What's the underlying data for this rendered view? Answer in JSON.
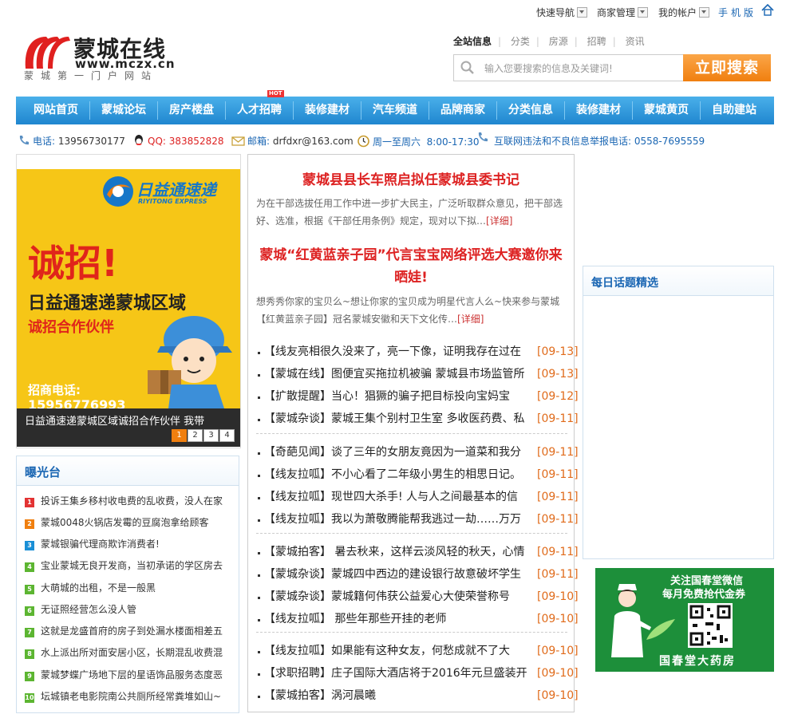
{
  "topbar": {
    "quick_nav": "快速导航",
    "merchant": "商家管理",
    "account": "我的帐户",
    "mobile": "手机版"
  },
  "logo": {
    "name": "蒙城在线",
    "url": "www.mczx.cn",
    "slogan": "蒙城第一门户网站"
  },
  "search": {
    "tabs": [
      "全站信息",
      "分类",
      "房源",
      "招聘",
      "资讯"
    ],
    "placeholder": "输入您要搜索的信息及关键词!",
    "button": "立即搜索"
  },
  "nav": {
    "items": [
      "网站首页",
      "蒙城论坛",
      "房产楼盘",
      "人才招聘",
      "装修建材",
      "汽车频道",
      "品牌商家",
      "分类信息",
      "装修建材",
      "蒙城黄页",
      "自助建站"
    ],
    "hot_badge": "HOT"
  },
  "contact": {
    "phone_label": "电话:",
    "phone": "13956730177",
    "qq_label": "QQ:",
    "qq": "383852828",
    "mail_label": "邮箱:",
    "mail": "drfdxr@163.com",
    "hours_days": "周一至周六",
    "hours_time": "8:00-17:30",
    "report_label": "互联网违法和不良信息举报电话:",
    "report_phone": "0558-7695559"
  },
  "banner": {
    "brand": "日益通速递",
    "brand_en": "RIYITONG EXPRESS",
    "headline": "诚招!",
    "line1": "日益通速递蒙城区域",
    "line2": "诚招合作伙伴",
    "phone_label": "招商电话:",
    "phone": "15956776993",
    "caption": "日益通速递蒙城区域诚招合作伙伴 我带",
    "pages": [
      "1",
      "2",
      "3",
      "4"
    ]
  },
  "exposure": {
    "title": "曝光台",
    "items": [
      "投诉王集乡移村收电费的乱收费，没人在家",
      "蒙城0048火锅店发霉的豆腐泡拿给顾客",
      "蒙城银骗代理商欺诈消费者!",
      "宝业蒙城无良开发商，当初承诺的学区房去",
      "大萌城的出租，不是一般黑",
      "无证照经营怎么没人管",
      "这就是龙盛首府的房子到处漏水楼面相差五",
      "水上派出所对面安居小区，长期混乱收费混",
      "蒙城梦蝶广场地下层的星语饰品服务态度恶",
      "坛城镇老电影院南公共厕所经常粪堆如山~"
    ],
    "colors": [
      "#e33333",
      "#f07f0f",
      "#1a8fd6",
      "#5cb531",
      "#5cb531",
      "#5cb531",
      "#5cb531",
      "#5cb531",
      "#5cb531",
      "#5cb531"
    ]
  },
  "center": {
    "headline1": "蒙城县县长车照启拟任蒙城县委书记",
    "summary1": "为在干部选拔任用工作中进一步扩大民主，广泛听取群众意见，把干部选好、选准，根据《干部任用条例》规定，现对以下拟…",
    "headline2": "蒙城“红黄蓝亲子园”代言宝宝网络评选大赛邀你来晒娃!",
    "summary2": "想秀秀你家的宝贝么~想让你家的宝贝成为明星代言人么~快来参与蒙城【红黄蓝亲子园】冠名蒙城安徽和天下文化传…",
    "more_label": "[详细]",
    "groups": [
      [
        {
          "title": "【线友亮相很久没来了，亮一下像，证明我存在过在",
          "date": "[09-13]"
        },
        {
          "title": "【蒙城在线】图便宜买拖拉机被骗 蒙城县市场监管所",
          "date": "[09-13]"
        },
        {
          "title": "【扩散提醒】当心！猖獗的骗子把目标投向宝妈宝",
          "date": "[09-12]"
        },
        {
          "title": "【蒙城杂谈】蒙城王集个别村卫生室 多收医药费、私",
          "date": "[09-11]"
        }
      ],
      [
        {
          "title": "【奇葩见闻】谈了三年的女朋友竟因为一道菜和我分",
          "date": "[09-11]"
        },
        {
          "title": "【线友拉呱】不小心看了二年级小男生的相思日记。",
          "date": "[09-11]"
        },
        {
          "title": "【线友拉呱】现世四大杀手! 人与人之间最基本的信",
          "date": "[09-11]"
        },
        {
          "title": "【线友拉呱】我以为萧敬腾能帮我逃过一劫……万万",
          "date": "[09-11]"
        }
      ],
      [
        {
          "title": "【蒙城拍客】 暑去秋来，这样云淡风轻的秋天，心情",
          "date": "[09-11]"
        },
        {
          "title": "【蒙城杂谈】蒙城四中西边的建设银行故意破坏学生",
          "date": "[09-11]"
        },
        {
          "title": "【蒙城杂谈】蒙城籍何伟获公益爱心大使荣誉称号",
          "date": "[09-10]"
        },
        {
          "title": "【线友拉呱】 那些年那些开挂的老师",
          "date": "[09-10]"
        }
      ],
      [
        {
          "title": "【线友拉呱】如果能有这种女友，何愁成就不了大",
          "date": "[09-10]"
        },
        {
          "title": "【求职招聘】庄子国际大酒店将于2016年元旦盛装开",
          "date": "[09-10]"
        },
        {
          "title": "【蒙城拍客】涡河晨曦",
          "date": "[09-10]"
        }
      ]
    ]
  },
  "right": {
    "topic_title": "每日话题精选",
    "ad_line1": "关注国春堂微信",
    "ad_line2": "每月免费抢代金券",
    "ad_brand": "国春堂大药房"
  },
  "colors": {
    "nav": "#2b93dc",
    "accent_orange": "#f07f0f",
    "headline_red": "#dd2222",
    "link_blue": "#1a66b3"
  }
}
